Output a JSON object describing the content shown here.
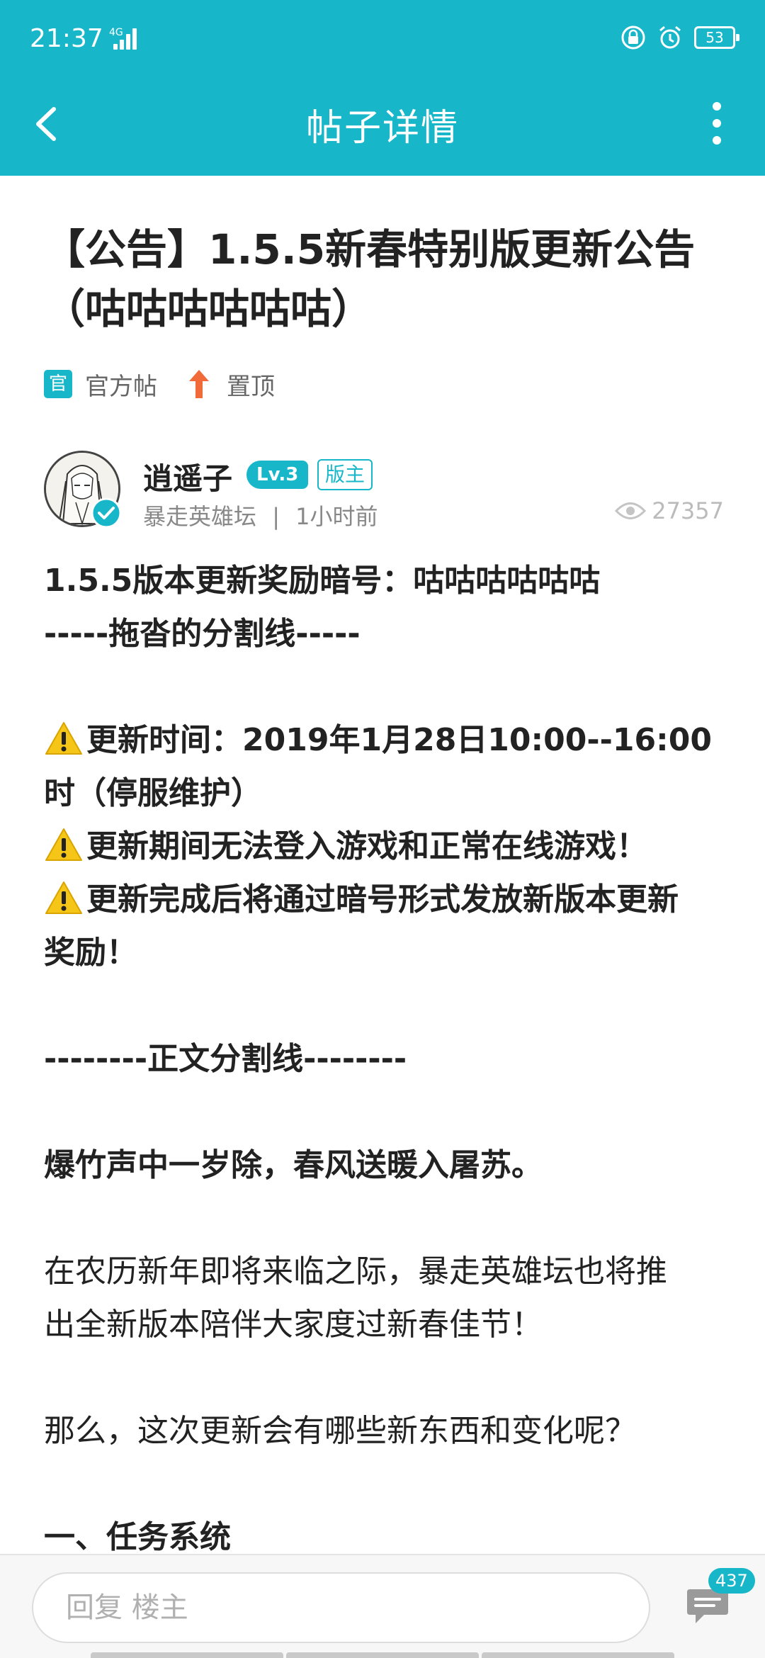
{
  "status_bar": {
    "time": "21:37",
    "network": "4G",
    "battery": "53",
    "icons": [
      "signal-icon",
      "lock-rotation-icon",
      "alarm-icon",
      "battery-icon"
    ]
  },
  "nav": {
    "title": "帖子详情",
    "back_icon": "chevron-left-icon",
    "more_icon": "more-vertical-icon"
  },
  "post": {
    "title": "【公告】1.5.5新春特别版更新公告（咕咕咕咕咕咕）",
    "tags": [
      {
        "badge": "官",
        "label": "官方帖"
      },
      {
        "label": "置顶",
        "icon": "arrow-up-icon"
      }
    ],
    "author": {
      "name": "逍遥子",
      "level": "Lv.3",
      "role": "版主",
      "forum": "暴走英雄坛",
      "separator": "|",
      "time": "1小时前"
    },
    "views": "27357",
    "body_lines": [
      {
        "text": "1.5.5版本更新奖励暗号：咕咕咕咕咕咕",
        "bold": true
      },
      {
        "text": "-----拖沓的分割线-----",
        "bold": true
      },
      {
        "text": "",
        "bold": false
      },
      {
        "text": "更新时间：2019年1月28日10:00--16:00",
        "bold": true,
        "warn": true
      },
      {
        "text": "时（停服维护）",
        "bold": true
      },
      {
        "text": "更新期间无法登入游戏和正常在线游戏！",
        "bold": true,
        "warn": true
      },
      {
        "text": "更新完成后将通过暗号形式发放新版本更新",
        "bold": true,
        "warn": true
      },
      {
        "text": "奖励！",
        "bold": true
      },
      {
        "text": "",
        "bold": false
      },
      {
        "text": "--------正文分割线--------",
        "bold": true
      },
      {
        "text": "",
        "bold": false
      },
      {
        "text": "爆竹声中一岁除，春风送暖入屠苏。",
        "bold": true
      },
      {
        "text": "",
        "bold": false
      },
      {
        "text": "在农历新年即将来临之际，暴走英雄坛也将推",
        "bold": false
      },
      {
        "text": "出全新版本陪伴大家度过新春佳节！",
        "bold": false
      },
      {
        "text": "",
        "bold": false
      },
      {
        "text": "那么，这次更新会有哪些新东西和变化呢？",
        "bold": false
      },
      {
        "text": "",
        "bold": false
      },
      {
        "text": "一、任务系统",
        "bold": true
      }
    ]
  },
  "bottom": {
    "reply_placeholder": "回复  楼主",
    "comment_count": "437"
  },
  "colors": {
    "accent": "#17b7c9",
    "pin": "#f06a3a",
    "warning": "#f5c518"
  }
}
